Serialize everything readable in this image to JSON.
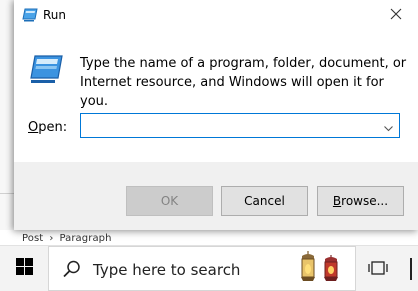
{
  "dialog": {
    "title": "Run",
    "description_line1": "Type the name of a program, folder, document, or",
    "description_line2": "Internet resource, and Windows will open it for you.",
    "open_label_accel": "O",
    "open_label_rest": "pen:",
    "open_value": "",
    "buttons": {
      "ok": "OK",
      "cancel": "Cancel",
      "browse_accel": "B",
      "browse_rest": "rowse..."
    }
  },
  "background": {
    "breadcrumb": [
      "Post",
      "Paragraph"
    ],
    "breadcrumb_separator": "›"
  },
  "taskbar": {
    "search_placeholder": "Type here to search"
  },
  "icons": {
    "title": "run-icon",
    "close": "close-icon",
    "dropdown": "chevron-down-icon",
    "start": "windows-logo-icon",
    "search": "search-icon",
    "task_view": "task-view-icon"
  },
  "colors": {
    "accent": "#0078d7",
    "footer": "#f0f0f0",
    "taskbar": "#f3f3f3"
  }
}
